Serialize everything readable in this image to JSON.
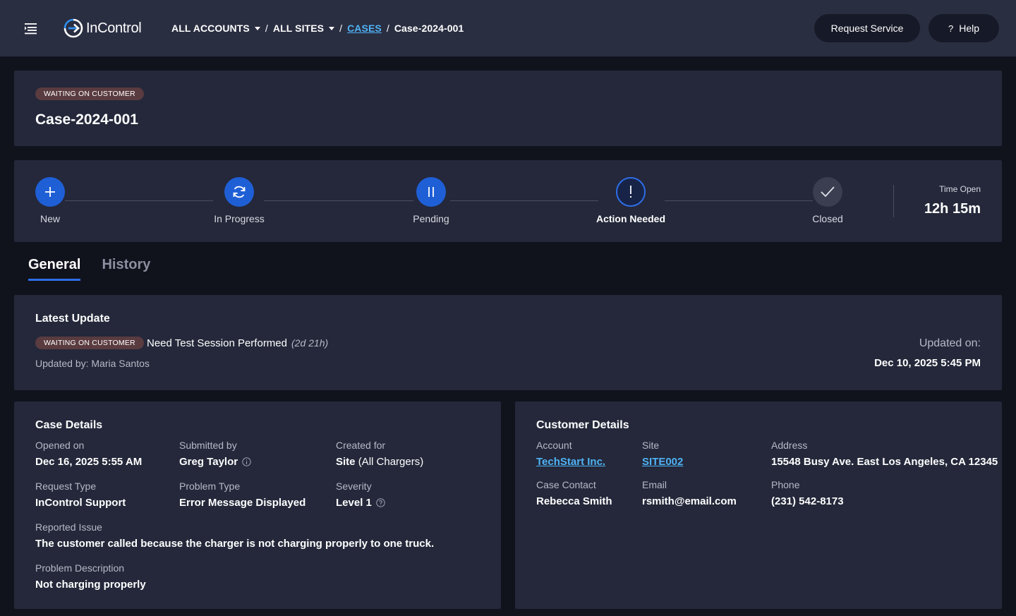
{
  "header": {
    "brand": "InControl",
    "breadcrumb": {
      "accounts": "ALL ACCOUNTS",
      "sites": "ALL SITES",
      "sep": "/",
      "cases": "CASES",
      "current": "Case-2024-001"
    },
    "request_service": "Request Service",
    "help": "Help",
    "help_glyph": "?"
  },
  "case": {
    "status_badge": "WAITING ON CUSTOMER",
    "title": "Case-2024-001"
  },
  "tracker": {
    "steps": [
      {
        "label": "New",
        "icon": "plus-icon"
      },
      {
        "label": "In Progress",
        "icon": "refresh-icon"
      },
      {
        "label": "Pending",
        "icon": "pause-icon"
      },
      {
        "label": "Action Needed",
        "icon": "exclamation-icon"
      },
      {
        "label": "Closed",
        "icon": "check-icon"
      }
    ],
    "current_step": "Action Needed",
    "time_open_label": "Time Open",
    "time_open_value": "12h 15m"
  },
  "tabs": [
    {
      "label": "General",
      "active": true
    },
    {
      "label": "History",
      "active": false
    }
  ],
  "latest_update": {
    "title": "Latest Update",
    "badge": "WAITING ON CUSTOMER",
    "text": "Need Test Session Performed",
    "age": "(2d 21h)",
    "updated_by": "Updated by: Maria Santos",
    "updated_on_label": "Updated on:",
    "updated_on_value": "Dec 10, 2025 5:45 PM"
  },
  "case_details": {
    "title": "Case Details",
    "opened_on_label": "Opened on",
    "opened_on_value": "Dec 16, 2025 5:55 AM",
    "submitted_by_label": "Submitted by",
    "submitted_by_value": "Greg Taylor",
    "created_for_label": "Created for",
    "created_for_value": "Site",
    "created_for_suffix": "(All Chargers)",
    "request_type_label": "Request Type",
    "request_type_value": "InControl Support",
    "problem_type_label": "Problem Type",
    "problem_type_value": "Error Message Displayed",
    "severity_label": "Severity",
    "severity_value": "Level 1",
    "reported_issue_label": "Reported Issue",
    "reported_issue_value": "The customer called because the charger is not charging properly to one truck.",
    "problem_description_label": "Problem Description",
    "problem_description_value": "Not charging properly"
  },
  "customer_details": {
    "title": "Customer Details",
    "account_label": "Account",
    "account_value": "TechStart Inc.",
    "site_label": "Site",
    "site_value": "SITE002",
    "address_label": "Address",
    "address_value": "15548 Busy Ave. East Los Angeles, CA 12345",
    "contact_label": "Case Contact",
    "contact_value": "Rebecca Smith",
    "email_label": "Email",
    "email_value": "rsmith@email.com",
    "phone_label": "Phone",
    "phone_value": "(231) 542-8173"
  },
  "colors": {
    "topbar": "#2a2e41",
    "background": "#10121c",
    "card": "#24283a",
    "accent_blue": "#1f5fd6",
    "link": "#4fb3f5",
    "badge": "#5a3b40"
  }
}
